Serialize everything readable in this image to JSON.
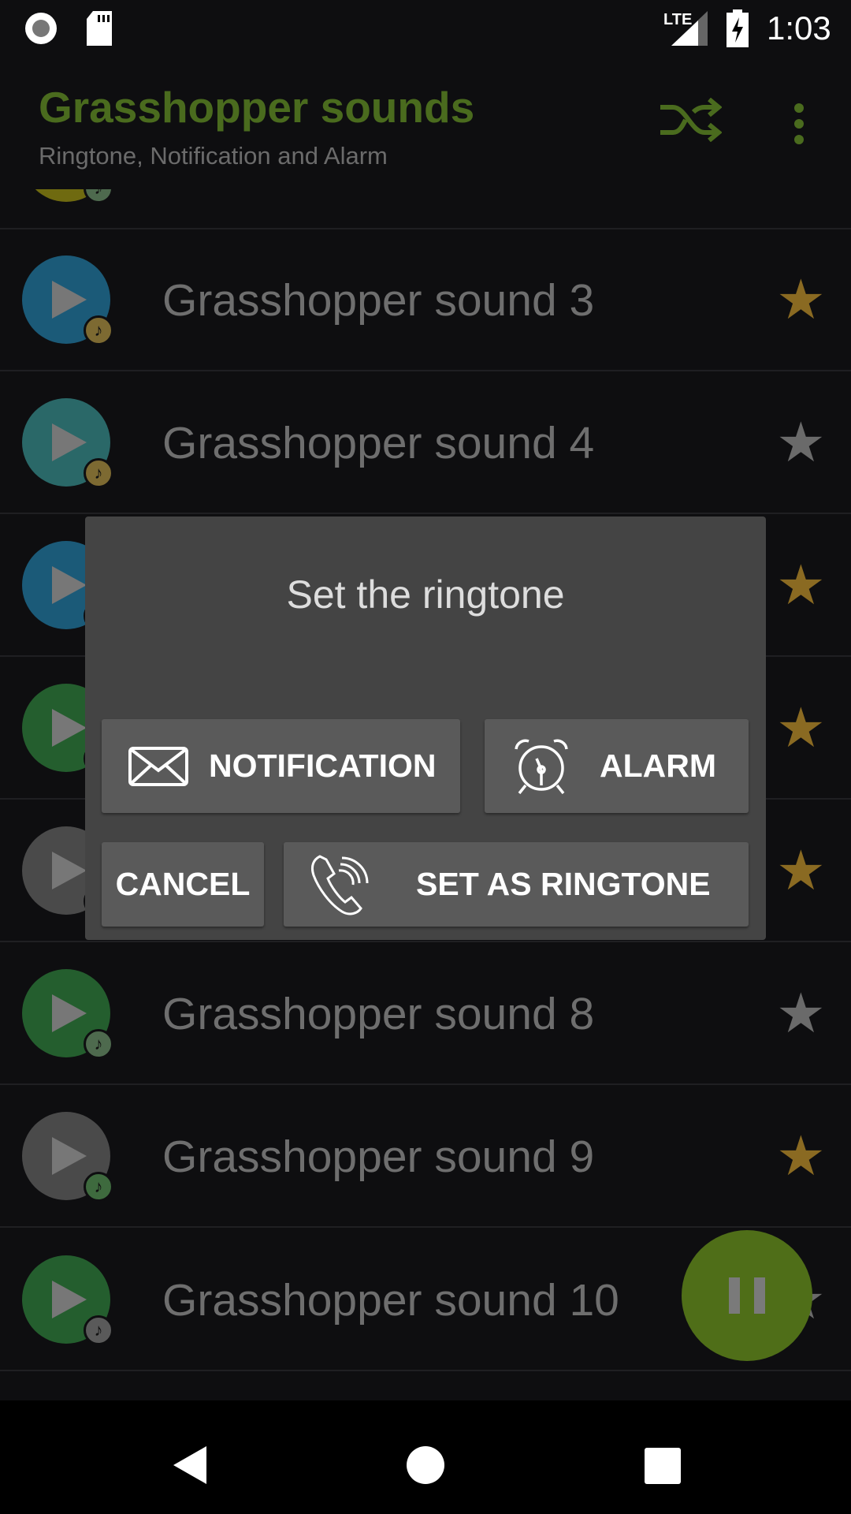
{
  "status_bar": {
    "time": "1:03",
    "network": "LTE"
  },
  "app_bar": {
    "title": "Grasshopper sounds",
    "subtitle": "Ringtone, Notification and Alarm",
    "icons": [
      "shuffle-icon",
      "more-vert-icon"
    ]
  },
  "colors": {
    "accent": "#4a6b1e",
    "fab": "#4f6e18",
    "dialog": "#444444",
    "button": "#5a5a5a",
    "star_on": "#8a6a22",
    "star_off": "#6a6a6a"
  },
  "list": [
    {
      "name": "",
      "circle": "#6f6a10",
      "badge": "#4e6a4e",
      "favorite": false
    },
    {
      "name": "Grasshopper sound 3",
      "circle": "#1b5a78",
      "badge": "#7d6a32",
      "favorite": true
    },
    {
      "name": "Grasshopper sound 4",
      "circle": "#2a6868",
      "badge": "#7d6a32",
      "favorite": false
    },
    {
      "name": "",
      "circle": "#1b5a78",
      "badge": "#7d6a32",
      "favorite": true
    },
    {
      "name": "",
      "circle": "#245e2e",
      "badge": "#4e6a4e",
      "favorite": true
    },
    {
      "name": "",
      "circle": "#4a4a4a",
      "badge": "#4e6a4e",
      "favorite": true
    },
    {
      "name": "Grasshopper sound 8",
      "circle": "#245e2e",
      "badge": "#4e6a4e",
      "favorite": false
    },
    {
      "name": "Grasshopper sound 9",
      "circle": "#4a4a4a",
      "badge": "#3e6a3e",
      "favorite": true
    },
    {
      "name": "Grasshopper sound 10",
      "circle": "#245e2e",
      "badge": "#5a5a5a",
      "favorite": false
    }
  ],
  "dialog": {
    "title": "Set the ringtone",
    "notification": "NOTIFICATION",
    "alarm": "ALARM",
    "cancel": "CANCEL",
    "set_ringtone": "SET AS RINGTONE"
  },
  "fab": {
    "icon": "pause-icon"
  },
  "nav": {
    "icons": [
      "back-icon",
      "home-icon",
      "recents-icon"
    ]
  }
}
